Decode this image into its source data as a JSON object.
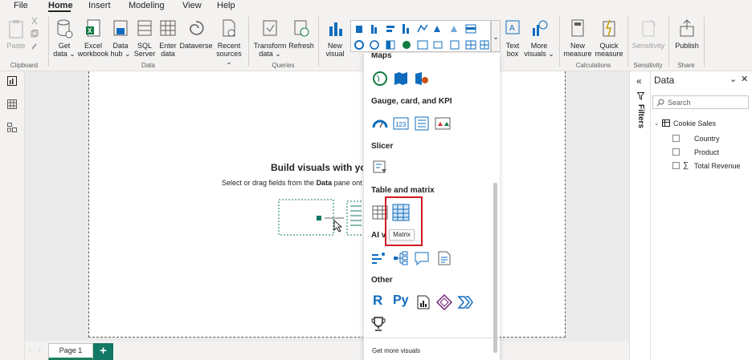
{
  "menu": {
    "items": [
      "File",
      "Home",
      "Insert",
      "Modeling",
      "View",
      "Help"
    ]
  },
  "ribbon": {
    "paste": "Paste",
    "get_data": "Get data",
    "excel_workbook": "Excel workbook",
    "data_hub": "Data hub",
    "sql_server": "SQL Server",
    "enter_data": "Enter data",
    "dataverse": "Dataverse",
    "recent_sources": "Recent sources",
    "transform_data": "Transform data",
    "refresh": "Refresh",
    "new_visual": "New visual",
    "text_box": "Text box",
    "more_visuals": "More visuals",
    "new_measure": "New measure",
    "quick_measure": "Quick measure",
    "sensitivity": "Sensitivity",
    "publish": "Publish",
    "groups": {
      "clipboard": "Clipboard",
      "data": "Data",
      "queries": "Queries",
      "calculations": "Calculations",
      "sensitivity": "Sensitivity",
      "share": "Share"
    }
  },
  "canvas": {
    "heading": "Build visuals with your d",
    "subtext_pre": "Select or drag fields from the ",
    "subtext_bold": "Data",
    "subtext_post": " pane ont"
  },
  "dropdown": {
    "maps": "Maps",
    "gauge": "Gauge, card, and KPI",
    "slicer": "Slicer",
    "table_matrix": "Table and matrix",
    "ai": "AI v",
    "other": "Other",
    "r_label": "R",
    "py_label": "Py",
    "get_more": "Get more visuals",
    "tooltip": "Matrix"
  },
  "filters": {
    "label": "Filters"
  },
  "data_pane": {
    "title": "Data",
    "search_placeholder": "Search",
    "table": "Cookie Sales",
    "fields": [
      "Country",
      "Product",
      "Total Revenue"
    ],
    "sigma": "∑"
  },
  "pages": {
    "tab": "Page 1",
    "add": "+"
  },
  "colors": {
    "accent": "#117865",
    "highlight": "#d0191d",
    "icon_blue": "#0f6cbd"
  }
}
